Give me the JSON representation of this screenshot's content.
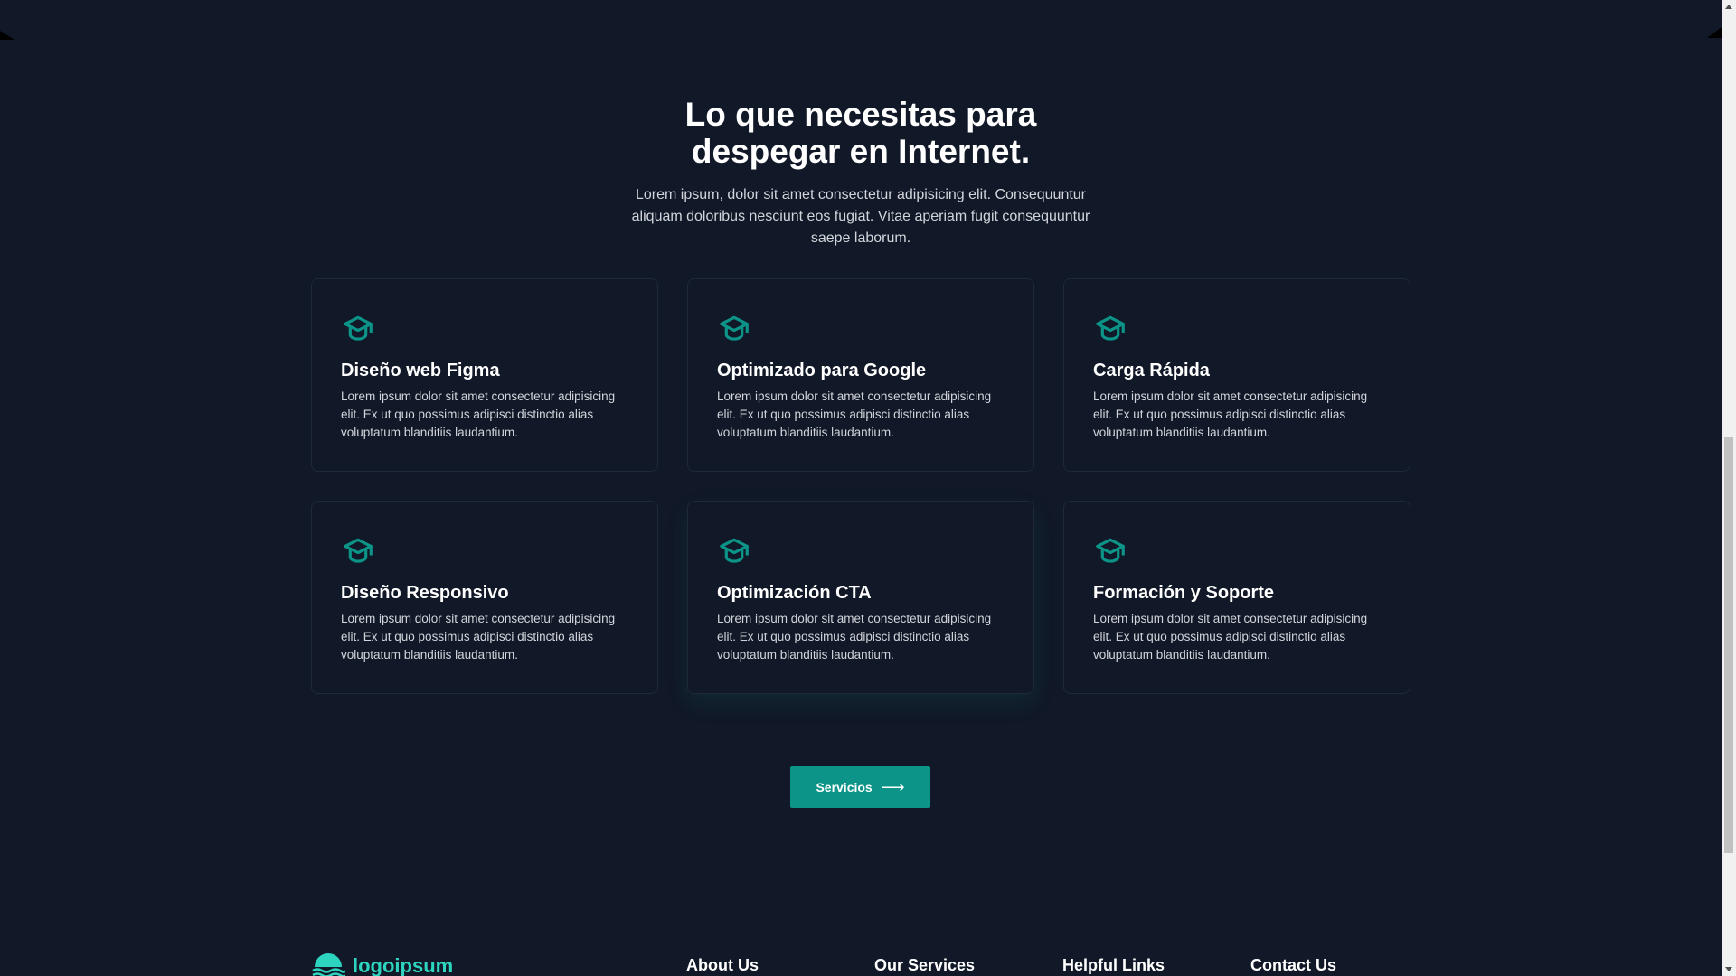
{
  "hero": {
    "title": "Lo que necesitas para despegar en Internet.",
    "description": "Lorem ipsum, dolor sit amet consectetur adipisicing elit. Consequuntur aliquam doloribus nesciunt eos fugiat. Vitae aperiam fugit consequuntur saepe laborum."
  },
  "features": [
    {
      "title": "Diseño web Figma",
      "description": "Lorem ipsum dolor sit amet consectetur adipisicing elit. Ex ut quo possimus adipisci distinctio alias voluptatum blanditiis laudantium.",
      "icon": "graduation-cap-icon"
    },
    {
      "title": "Optimizado para Google",
      "description": "Lorem ipsum dolor sit amet consectetur adipisicing elit. Ex ut quo possimus adipisci distinctio alias voluptatum blanditiis laudantium.",
      "icon": "graduation-cap-icon"
    },
    {
      "title": "Carga Rápida",
      "description": "Lorem ipsum dolor sit amet consectetur adipisicing elit. Ex ut quo possimus adipisci distinctio alias voluptatum blanditiis laudantium.",
      "icon": "graduation-cap-icon"
    },
    {
      "title": "Diseño Responsivo",
      "description": "Lorem ipsum dolor sit amet consectetur adipisicing elit. Ex ut quo possimus adipisci distinctio alias voluptatum blanditiis laudantium.",
      "icon": "graduation-cap-icon"
    },
    {
      "title": "Optimización CTA",
      "description": "Lorem ipsum dolor sit amet consectetur adipisicing elit. Ex ut quo possimus adipisci distinctio alias voluptatum blanditiis laudantium.",
      "icon": "graduation-cap-icon"
    },
    {
      "title": "Formación y Soporte",
      "description": "Lorem ipsum dolor sit amet consectetur adipisicing elit. Ex ut quo possimus adipisci distinctio alias voluptatum blanditiis laudantium.",
      "icon": "graduation-cap-icon"
    }
  ],
  "cta": {
    "label": "Servicios",
    "icon": "arrow-right-icon",
    "arrow": "⟶"
  },
  "footer": {
    "logo_text": "logoipsum",
    "logo_icon": "wave-logo-icon",
    "columns": [
      "About Us",
      "Our Services",
      "Helpful Links",
      "Contact Us"
    ]
  },
  "colors": {
    "background": "#111827",
    "accent": "#0d9488",
    "accent_light": "#2dd4bf",
    "card_border": "#1f2937",
    "body_text": "#d1d5db"
  }
}
